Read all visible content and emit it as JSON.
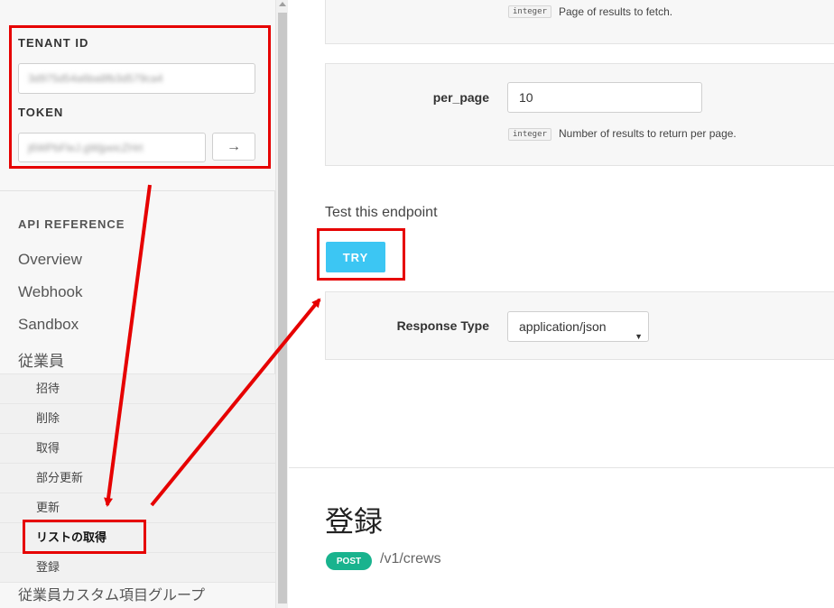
{
  "sidebar": {
    "tenant_label": "TENANT ID",
    "tenant_value": "3d975d54a6ba8fb3d579ca4",
    "token_label": "TOKEN",
    "token_value": "j6WPbFleJ.gWjpeicZHrt",
    "go_icon": "→",
    "api_heading": "API REFERENCE",
    "nav": [
      "Overview",
      "Webhook",
      "Sandbox",
      "従業員"
    ],
    "sub_items": [
      "招待",
      "削除",
      "取得",
      "部分更新",
      "更新",
      "リストの取得",
      "登録"
    ],
    "nav_bottom": "従業員カスタム項目グループ"
  },
  "params": {
    "page": {
      "type": "integer",
      "description": "Page of results to fetch."
    },
    "per_page": {
      "name": "per_page",
      "value": "10",
      "type": "integer",
      "description": "Number of results to return per page."
    }
  },
  "test": {
    "title": "Test this endpoint",
    "try_label": "TRY",
    "response_type_label": "Response Type",
    "response_type_value": "application/json",
    "caret": "▼"
  },
  "section": {
    "title": "登録",
    "method": "POST",
    "path": "/v1/crews"
  },
  "colors": {
    "annotation_red": "#e60000",
    "try_button": "#3cc6f3",
    "post_badge": "#19b38e"
  }
}
